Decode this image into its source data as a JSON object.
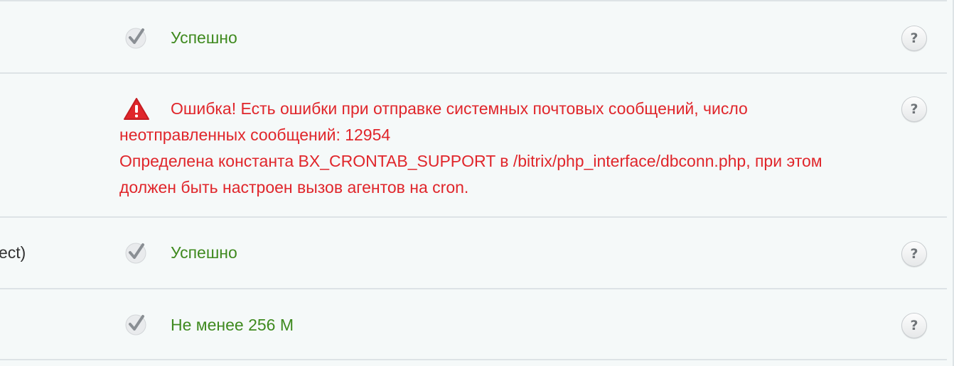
{
  "rows": [
    {
      "label": "",
      "status": "ok",
      "text": "Успешно",
      "help": "?"
    },
    {
      "label": "",
      "status": "error",
      "text_line1": "Ошибка! Есть ошибки при отправке системных почтовых сообщений, число",
      "text_line2": "неотправленных сообщений: 12954",
      "text_line3": "Определена константа BX_CRONTAB_SUPPORT в /bitrix/php_interface/dbconn.php, при этом",
      "text_line4": "должен быть настроен вызов агентов на cron.",
      "help": "?"
    },
    {
      "label": "ect)",
      "status": "ok",
      "text": "Успешно",
      "help": "?"
    },
    {
      "label": "",
      "status": "ok",
      "text": "Не менее 256 М",
      "help": "?"
    }
  ],
  "icons": {
    "ok": "check-circle-icon",
    "error": "warning-triangle-icon",
    "help": "help-circle-icon"
  },
  "colors": {
    "ok_text": "#3f8a1f",
    "error_text": "#e0262b",
    "border": "#dde3e6",
    "background": "#f5f9f9"
  }
}
